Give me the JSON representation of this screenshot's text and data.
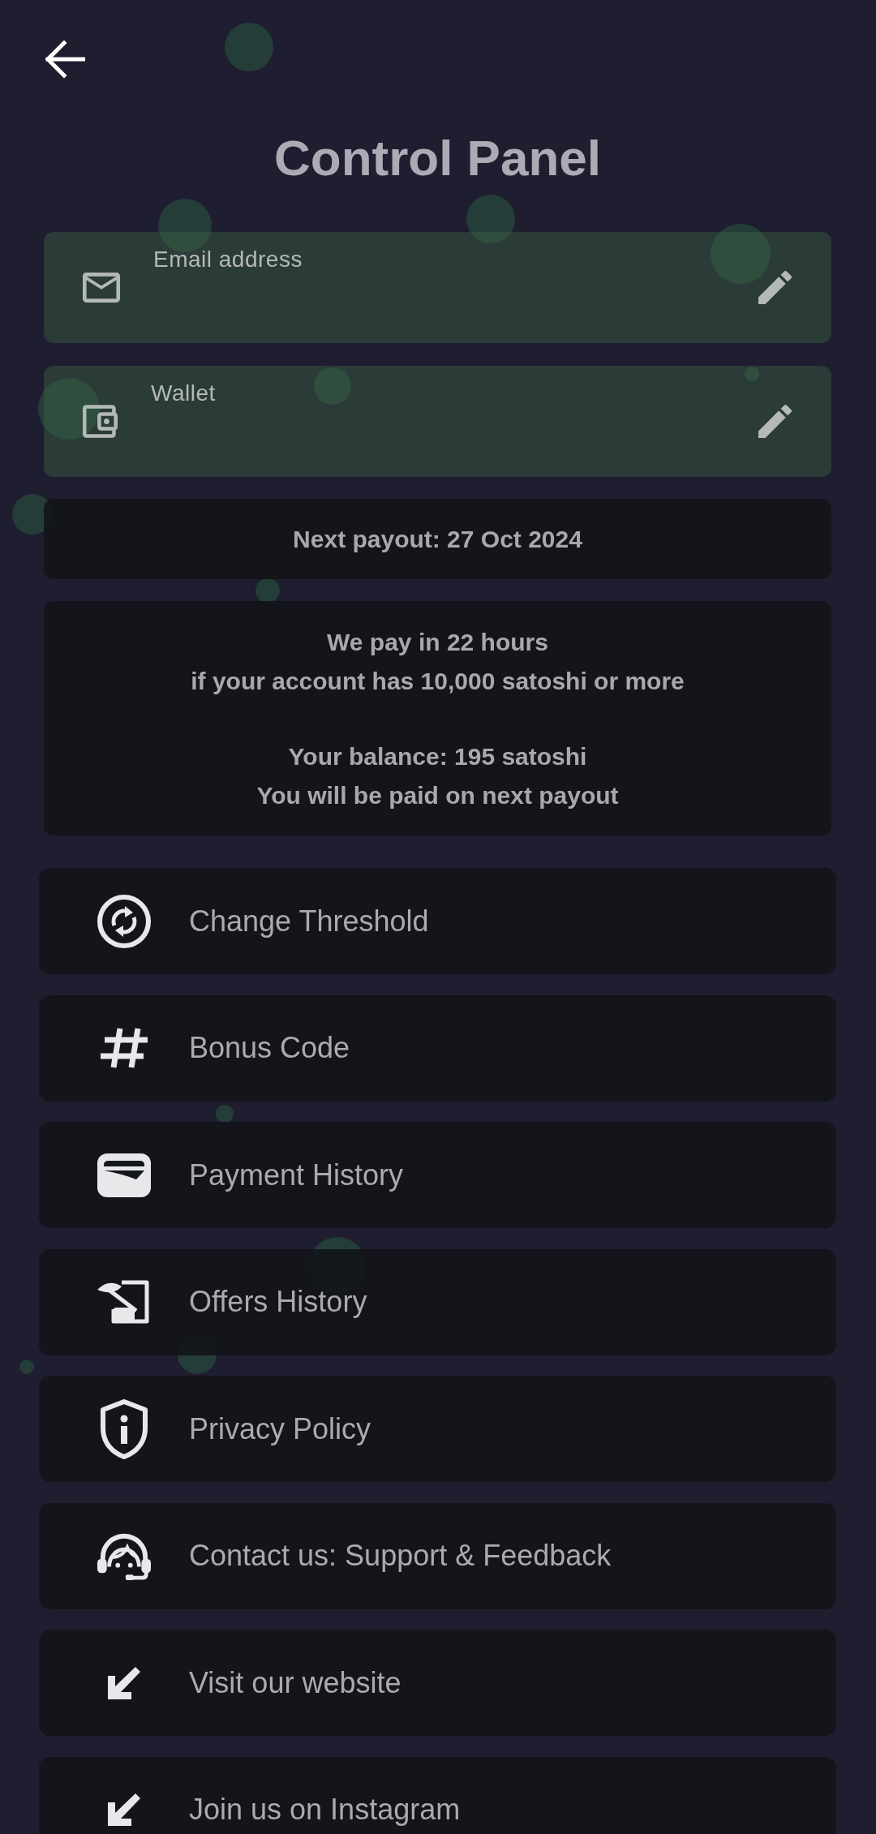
{
  "header": {
    "title": "Control Panel"
  },
  "fields": [
    {
      "label": "Email address"
    },
    {
      "label": "Wallet"
    }
  ],
  "next_payout": {
    "text": "Next payout: 27 Oct 2024"
  },
  "payout_info": {
    "paragraphs": [
      [
        "We pay in 22 hours",
        "if your account has 10,000 satoshi or more"
      ],
      [
        "Your balance: 195 satoshi",
        "You will be paid on next payout"
      ]
    ]
  },
  "menu": [
    {
      "label": "Change Threshold"
    },
    {
      "label": "Bonus Code"
    },
    {
      "label": "Payment History"
    },
    {
      "label": "Offers History"
    },
    {
      "label": "Privacy Policy"
    },
    {
      "label": "Contact us: Support & Feedback"
    },
    {
      "label": "Visit our website"
    },
    {
      "label": "Join us on Instagram"
    }
  ]
}
